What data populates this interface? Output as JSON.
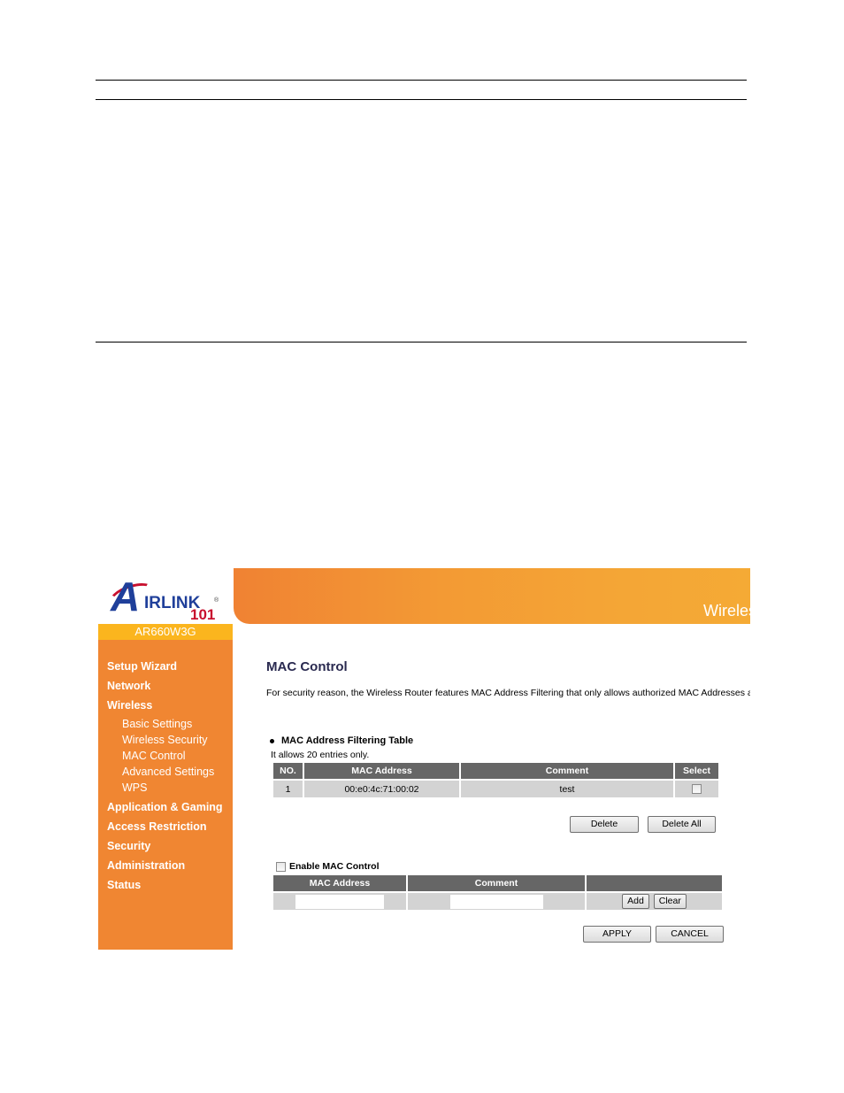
{
  "document": {
    "rules_count": 3
  },
  "router_ui": {
    "logo": {
      "brand_a": "A",
      "brand_rest": "IRLINK",
      "brand_number": "101",
      "registered_mark": "®"
    },
    "model": "AR660W3G",
    "banner_title": "Wireless",
    "colors": {
      "sidebar": "#f08632",
      "model_bar": "#fbb51e",
      "banner_start": "#f08233",
      "banner_end": "#f5aa35",
      "table_header": "#666666",
      "table_cell": "#d3d3d3",
      "title_text": "#2a2a50"
    },
    "sidebar": {
      "items": [
        {
          "label": "Setup Wizard"
        },
        {
          "label": "Network"
        },
        {
          "label": "Wireless"
        },
        {
          "label": "Basic Settings",
          "sub": true
        },
        {
          "label": "Wireless Security",
          "sub": true
        },
        {
          "label": "MAC Control",
          "sub": true,
          "active": true
        },
        {
          "label": "Advanced Settings",
          "sub": true
        },
        {
          "label": "WPS",
          "sub": true
        },
        {
          "label": "Application & Gaming"
        },
        {
          "label": "Access Restriction"
        },
        {
          "label": "Security"
        },
        {
          "label": "Administration"
        },
        {
          "label": "Status"
        }
      ]
    },
    "main": {
      "title": "MAC Control",
      "intro": "For security reason, the Wireless Router features MAC Address Filtering that only allows authorized MAC Addresses as",
      "filter_table": {
        "heading": "MAC Address Filtering Table",
        "note": "It allows 20 entries only.",
        "columns": [
          "NO.",
          "MAC Address",
          "Comment",
          "Select"
        ],
        "rows": [
          {
            "no": "1",
            "mac": "00:e0:4c:71:00:02",
            "comment": "test",
            "selected": false
          }
        ],
        "delete_label": "Delete",
        "delete_all_label": "Delete All"
      },
      "add_form": {
        "enable_label": "Enable MAC Control",
        "enabled": false,
        "columns": [
          "MAC Address",
          "Comment",
          ""
        ],
        "mac_value": "",
        "comment_value": "",
        "add_label": "Add",
        "clear_label": "Clear"
      },
      "apply_label": "APPLY",
      "cancel_label": "CANCEL"
    }
  }
}
